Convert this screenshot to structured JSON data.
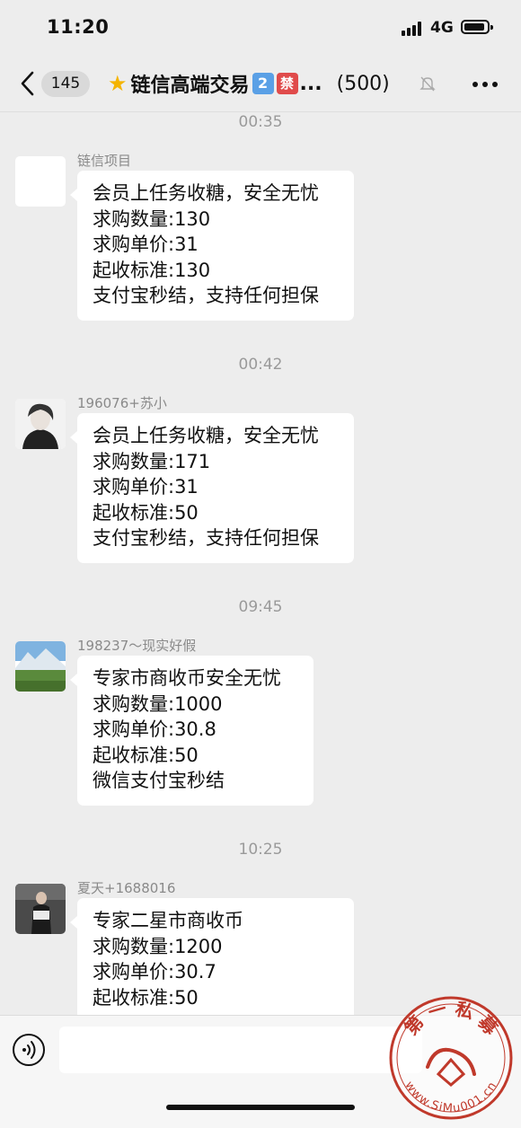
{
  "status_bar": {
    "time": "11:20",
    "network": "4G"
  },
  "nav": {
    "unread_count": "145",
    "title": "链信高端交易",
    "badge_number": "2",
    "badge_ban": "禁",
    "ellipsis": "...",
    "member_count": "(500)"
  },
  "messages": [
    {
      "timestamp": "00:35",
      "sender": "链信项目",
      "lines": [
        "会员上任务收糖，安全无忧",
        "求购数量:130",
        "求购单价:31",
        "起收标准:130",
        "支付宝秒结，支持任何担保"
      ]
    },
    {
      "timestamp": "00:42",
      "sender": "196076+苏小",
      "lines": [
        "会员上任务收糖，安全无忧",
        "求购数量:171",
        "求购单价:31",
        "起收标准:50",
        "支付宝秒结，支持任何担保"
      ]
    },
    {
      "timestamp": "09:45",
      "sender": "198237～现实好假",
      "lines": [
        "专家市商收币安全无忧",
        "求购数量:1000",
        "求购单价:30.8",
        "起收标准:50",
        "微信支付宝秒结"
      ]
    },
    {
      "timestamp": "10:25",
      "sender": "夏天+1688016",
      "lines": [
        "专家二星市商收币",
        "求购数量:1200",
        "求购单价:30.7",
        "起收标准:50"
      ]
    }
  ],
  "input": {
    "value": ""
  },
  "watermark": {
    "text_cn": "第一私募",
    "url": "www.SiMu001.cn"
  },
  "colors": {
    "background": "#ededed",
    "bubble": "#ffffff",
    "timestamp": "#9a9a9a",
    "star": "#f4b400",
    "badge_blue": "#5aa0e6",
    "badge_red": "#e04b4b",
    "watermark": "#c0392b"
  }
}
